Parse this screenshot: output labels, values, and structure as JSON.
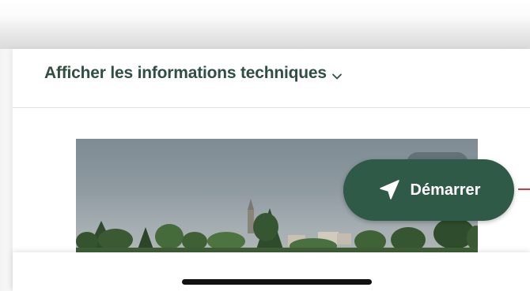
{
  "tech_info": {
    "label": "Afficher les informations techniques",
    "icon": "chevron-down-icon"
  },
  "photo": {
    "subject": "village-skyline-photo"
  },
  "start_button": {
    "label": "Démarrer",
    "icon": "navigation-arrow-icon",
    "color": "#2f5a47"
  },
  "colors": {
    "accent": "#2f5a47",
    "title_text": "#2f4f42"
  }
}
